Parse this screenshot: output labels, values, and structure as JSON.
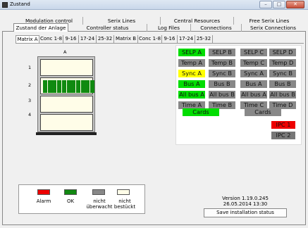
{
  "window": {
    "title": "Zustand"
  },
  "tabs_row1": [
    "Modulation control",
    "Serix Lines",
    "Central Resources",
    "Free Serix Lines"
  ],
  "tabs_row2": [
    "Zustand der Anlage",
    "Controller status",
    "Log Files",
    "Connections",
    "Serix Connections"
  ],
  "subtabs": [
    "Matrix A",
    "Conc 1-8",
    "9-16",
    "17-24",
    "25-32",
    "Matrix B",
    "Conc 1-8",
    "9-16",
    "17-24",
    "25-32"
  ],
  "rack": {
    "column_label": "A",
    "rows": [
      "1",
      "2",
      "3",
      "4"
    ]
  },
  "status_buttons": [
    {
      "label": "SELP A",
      "color": "#00dd00"
    },
    {
      "label": "SELP B",
      "color": "#888888"
    },
    {
      "label": "SELP C",
      "color": "#888888"
    },
    {
      "label": "SELP D",
      "color": "#888888"
    },
    {
      "label": "Temp A",
      "color": "#888888"
    },
    {
      "label": "Temp B",
      "color": "#888888"
    },
    {
      "label": "Temp C",
      "color": "#888888"
    },
    {
      "label": "Temp D",
      "color": "#888888"
    },
    {
      "label": "Sync A",
      "color": "#ffff00"
    },
    {
      "label": "Sync B",
      "color": "#888888"
    },
    {
      "label": "Sync A",
      "color": "#888888"
    },
    {
      "label": "Sync B",
      "color": "#888888"
    },
    {
      "label": "Bus A",
      "color": "#00dd00"
    },
    {
      "label": "Bus B",
      "color": "#888888"
    },
    {
      "label": "Bus A",
      "color": "#888888"
    },
    {
      "label": "Bus B",
      "color": "#888888"
    },
    {
      "label": "All bus A",
      "color": "#00dd00"
    },
    {
      "label": "All bus B",
      "color": "#888888"
    },
    {
      "label": "All bus A",
      "color": "#888888"
    },
    {
      "label": "All bus B",
      "color": "#888888"
    },
    {
      "label": "Time A",
      "color": "#888888"
    },
    {
      "label": "Time B",
      "color": "#888888"
    },
    {
      "label": "Time C",
      "color": "#888888"
    },
    {
      "label": "Time D",
      "color": "#888888"
    }
  ],
  "cards_buttons": [
    {
      "label": "Cards",
      "color": "#00dd00"
    },
    {
      "label": "Cards",
      "color": "#888888"
    }
  ],
  "ipc_buttons": [
    {
      "label": "IPC 1",
      "color": "#ee0000"
    },
    {
      "label": "IPC 2",
      "color": "#777777"
    }
  ],
  "legend": [
    {
      "label": "Alarm",
      "color": "#ee0000"
    },
    {
      "label": "OK",
      "color": "#118811"
    },
    {
      "label": "nicht\nüberwacht",
      "color": "#888888"
    },
    {
      "label": "nicht\nbestückt",
      "color": "#fffde8"
    }
  ],
  "version": "Version 1.19.0.245",
  "datetime": "26.05.2014 13:30",
  "save_label": "Save installation status",
  "card_slots_filled": 11
}
